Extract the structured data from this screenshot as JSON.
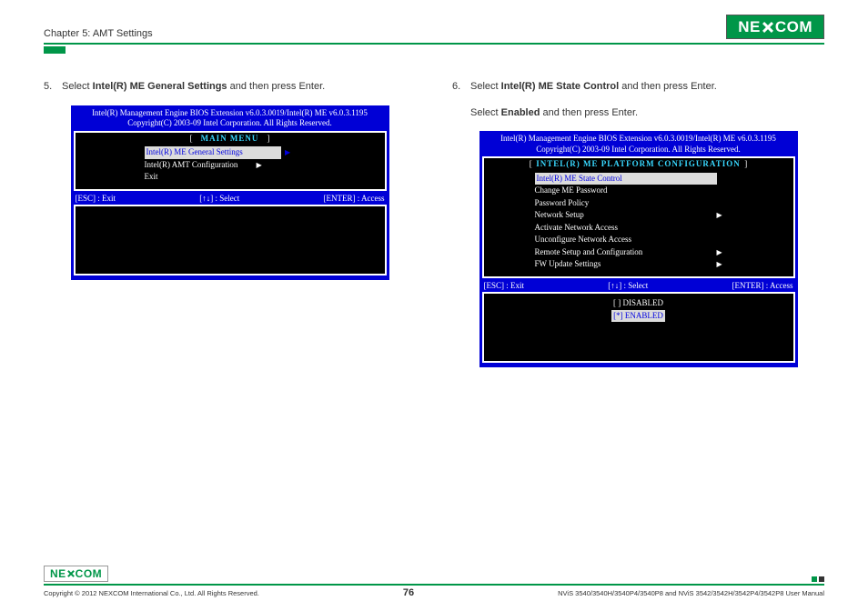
{
  "header": {
    "chapter": "Chapter 5: AMT Settings",
    "logo": "NEXCOM"
  },
  "left": {
    "step_num": "5.",
    "step_text_pre": "Select ",
    "step_text_bold": "Intel(R) ME General Settings",
    "step_text_post": " and then press Enter.",
    "bios": {
      "hdr1": "Intel(R) Management Engine BIOS Extension v6.0.3.0019/Intel(R) ME v6.0.3.1195",
      "hdr2": "Copyright(C) 2003-09 Intel Corporation. All Rights Reserved.",
      "title": "MAIN MENU",
      "items": [
        {
          "label": "Intel(R) ME General Settings",
          "highlight": true,
          "arrow": true
        },
        {
          "label": "Intel(R) AMT Configuration",
          "highlight": false,
          "arrow": true
        },
        {
          "label": "Exit",
          "highlight": false,
          "arrow": false
        }
      ],
      "footer": {
        "esc": "[ESC] : Exit",
        "sel": "[↑↓] : Select",
        "ent": "[ENTER] : Access"
      }
    }
  },
  "right": {
    "step_num": "6.",
    "step_text_pre": "Select ",
    "step_text_bold": "Intel(R) ME State Control",
    "step_text_post": " and then press Enter.",
    "sub_pre": "Select ",
    "sub_bold": "Enabled",
    "sub_post": "  and then press Enter.",
    "bios": {
      "hdr1": "Intel(R) Management Engine BIOS Extension v6.0.3.0019/Intel(R) ME v6.0.3.1195",
      "hdr2": "Copyright(C) 2003-09 Intel Corporation. All Rights Reserved.",
      "title": "INTEL(R) ME PLATFORM CONFIGURATION",
      "items": [
        {
          "label": "Intel(R) ME State Control",
          "highlight": true,
          "arrow": false
        },
        {
          "label": "Change ME Password",
          "highlight": false,
          "arrow": false
        },
        {
          "label": "Password Policy",
          "highlight": false,
          "arrow": false
        },
        {
          "label": "Network Setup",
          "highlight": false,
          "arrow": true
        },
        {
          "label": "Activate Network Access",
          "highlight": false,
          "arrow": false
        },
        {
          "label": "Unconfigure Network Access",
          "highlight": false,
          "arrow": false
        },
        {
          "label": "Remote Setup and Configuration",
          "highlight": false,
          "arrow": true
        },
        {
          "label": "FW Update Settings",
          "highlight": false,
          "arrow": true
        }
      ],
      "footer": {
        "esc": "[ESC] : Exit",
        "sel": "[↑↓] : Select",
        "ent": "[ENTER] : Access"
      },
      "options": {
        "disabled": "[  ] DISABLED",
        "enabled": "[*] ENABLED"
      }
    }
  },
  "footer": {
    "copyright": "Copyright © 2012 NEXCOM International Co., Ltd. All Rights Reserved.",
    "pagenum": "76",
    "manual": "NViS 3540/3540H/3540P4/3540P8 and NViS 3542/3542H/3542P4/3542P8 User Manual"
  }
}
